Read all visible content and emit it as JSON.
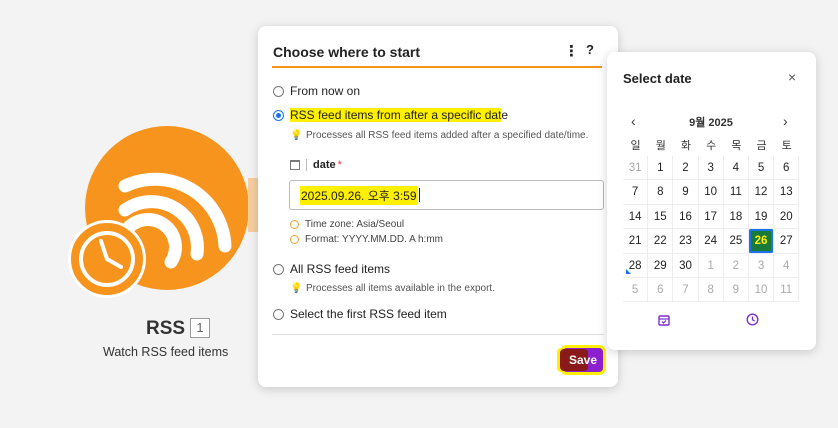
{
  "module": {
    "title": "RSS",
    "badge": "1",
    "subtitle": "Watch RSS feed items"
  },
  "dialog": {
    "title": "Choose where to start",
    "menu_icon": "more-vertical-icon",
    "help_label": "?",
    "options": [
      {
        "label": "From now on",
        "checked": false
      },
      {
        "label_highlighted": "RSS feed items from after a specific dat",
        "label_rest": "e",
        "checked": true
      },
      {
        "label": "All RSS feed items",
        "checked": false
      },
      {
        "label": "Select the first RSS feed item",
        "checked": false
      }
    ],
    "hint_specific_date": "Processes all RSS feed items added after a specified date/time.",
    "hint_all": "Processes all items available in the export.",
    "date_field": {
      "label": "date",
      "required_marker": "*",
      "value": "2025.09.26. 오후 3:59"
    },
    "timezone": "Time zone: Asia/Seoul",
    "format": "Format: YYYY.MM.DD. A h:mm",
    "save_label": "Save"
  },
  "picker": {
    "title": "Select date",
    "close": "×",
    "month": "9월 2025",
    "weekdays": [
      "일",
      "월",
      "화",
      "수",
      "목",
      "금",
      "토"
    ],
    "days": [
      {
        "d": "31",
        "out": true
      },
      {
        "d": "1"
      },
      {
        "d": "2"
      },
      {
        "d": "3"
      },
      {
        "d": "4"
      },
      {
        "d": "5"
      },
      {
        "d": "6"
      },
      {
        "d": "7"
      },
      {
        "d": "8"
      },
      {
        "d": "9"
      },
      {
        "d": "10"
      },
      {
        "d": "11"
      },
      {
        "d": "12"
      },
      {
        "d": "13"
      },
      {
        "d": "14"
      },
      {
        "d": "15"
      },
      {
        "d": "16"
      },
      {
        "d": "17"
      },
      {
        "d": "18"
      },
      {
        "d": "19"
      },
      {
        "d": "20"
      },
      {
        "d": "21"
      },
      {
        "d": "22"
      },
      {
        "d": "23"
      },
      {
        "d": "24"
      },
      {
        "d": "25"
      },
      {
        "d": "26",
        "selected": true
      },
      {
        "d": "27"
      },
      {
        "d": "28",
        "marked": true
      },
      {
        "d": "29"
      },
      {
        "d": "30"
      },
      {
        "d": "1",
        "out": true
      },
      {
        "d": "2",
        "out": true
      },
      {
        "d": "3",
        "out": true
      },
      {
        "d": "4",
        "out": true
      },
      {
        "d": "5",
        "out": true
      },
      {
        "d": "6",
        "out": true
      },
      {
        "d": "7",
        "out": true
      },
      {
        "d": "8",
        "out": true
      },
      {
        "d": "9",
        "out": true
      },
      {
        "d": "10",
        "out": true
      },
      {
        "d": "11",
        "out": true
      }
    ],
    "colors": {
      "accent": "#f7941d",
      "selected_bg": "#1a7a3a",
      "save": "#8d1fcf",
      "highlight": "#ffef00"
    }
  }
}
